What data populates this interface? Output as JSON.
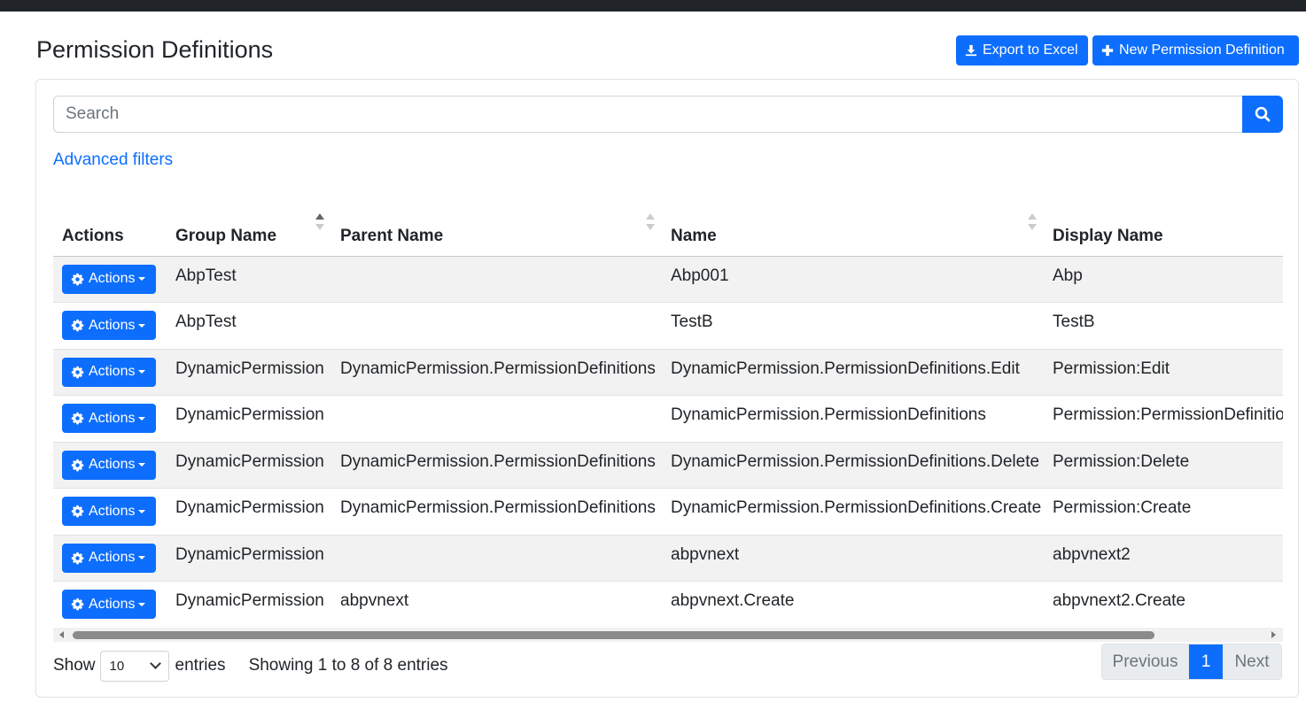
{
  "page": {
    "title": "Permission Definitions"
  },
  "toolbar": {
    "export_label": "Export to Excel",
    "new_label": "New Permission Definition"
  },
  "search": {
    "placeholder": "Search"
  },
  "filters": {
    "advanced_label": "Advanced filters"
  },
  "table": {
    "columns": [
      "Actions",
      "Group Name",
      "Parent Name",
      "Name",
      "Display Name"
    ],
    "action_label": "Actions",
    "rows": [
      {
        "group": "AbpTest",
        "parent": "",
        "name": "Abp001",
        "display": "Abp"
      },
      {
        "group": "AbpTest",
        "parent": "",
        "name": "TestB",
        "display": "TestB"
      },
      {
        "group": "DynamicPermission",
        "parent": "DynamicPermission.PermissionDefinitions",
        "name": "DynamicPermission.PermissionDefinitions.Edit",
        "display": "Permission:Edit"
      },
      {
        "group": "DynamicPermission",
        "parent": "",
        "name": "DynamicPermission.PermissionDefinitions",
        "display": "Permission:PermissionDefinitio"
      },
      {
        "group": "DynamicPermission",
        "parent": "DynamicPermission.PermissionDefinitions",
        "name": "DynamicPermission.PermissionDefinitions.Delete",
        "display": "Permission:Delete"
      },
      {
        "group": "DynamicPermission",
        "parent": "DynamicPermission.PermissionDefinitions",
        "name": "DynamicPermission.PermissionDefinitions.Create",
        "display": "Permission:Create"
      },
      {
        "group": "DynamicPermission",
        "parent": "",
        "name": "abpvnext",
        "display": "abpvnext2"
      },
      {
        "group": "DynamicPermission",
        "parent": "abpvnext",
        "name": "abpvnext.Create",
        "display": "abpvnext2.Create"
      }
    ]
  },
  "footer": {
    "show_label": "Show",
    "page_length": "10",
    "entries_label": "entries",
    "info": "Showing 1 to 8 of 8 entries"
  },
  "pagination": {
    "previous": "Previous",
    "current": "1",
    "next": "Next"
  },
  "colors": {
    "primary": "#0d6efd",
    "topbar": "#212529",
    "stripe": "#f2f2f2"
  }
}
